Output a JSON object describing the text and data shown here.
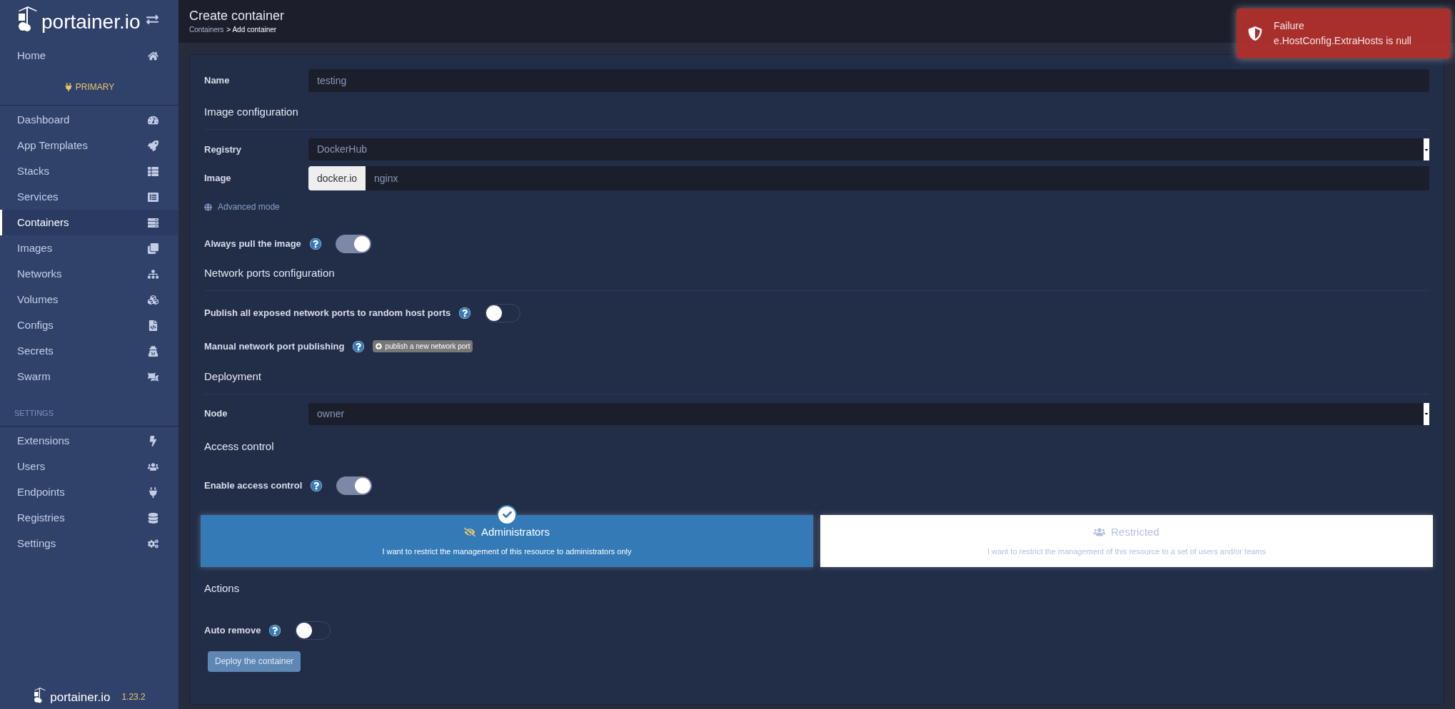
{
  "sidebar": {
    "logo": "portainer.io",
    "home": {
      "label": "Home",
      "selected": false
    },
    "endpoint": "PRIMARY",
    "items": [
      {
        "label": "Dashboard",
        "selected": false
      },
      {
        "label": "App Templates",
        "selected": false
      },
      {
        "label": "Stacks",
        "selected": false
      },
      {
        "label": "Services",
        "selected": false
      },
      {
        "label": "Containers",
        "selected": true
      },
      {
        "label": "Images",
        "selected": false
      },
      {
        "label": "Networks",
        "selected": false
      },
      {
        "label": "Volumes",
        "selected": false
      },
      {
        "label": "Configs",
        "selected": false
      },
      {
        "label": "Secrets",
        "selected": false
      },
      {
        "label": "Swarm",
        "selected": false
      }
    ],
    "settings_heading": "SETTINGS",
    "settings_items": [
      {
        "label": "Extensions",
        "selected": false
      },
      {
        "label": "Users",
        "selected": false
      },
      {
        "label": "Endpoints",
        "selected": false
      },
      {
        "label": "Registries",
        "selected": false
      },
      {
        "label": "Settings",
        "selected": false
      }
    ],
    "footer": {
      "logo": "portainer.io",
      "version": "1.23.2"
    }
  },
  "header": {
    "title": "Create container",
    "breadcrumb_link": "Containers",
    "breadcrumb_current": "> Add container"
  },
  "toast": {
    "title": "Failure",
    "message": "e.HostConfig.ExtraHosts is null"
  },
  "form": {
    "name": {
      "label": "Name",
      "value": "testing"
    },
    "image_heading": "Image configuration",
    "registry": {
      "label": "Registry",
      "value": "DockerHub"
    },
    "image": {
      "label": "Image",
      "prefix": "docker.io",
      "value": "nginx"
    },
    "advanced_mode": "Advanced mode",
    "always_pull": {
      "label": "Always pull the image",
      "on": true
    },
    "ports_heading": "Network ports configuration",
    "publish_all": {
      "label": "Publish all exposed network ports to random host ports",
      "on": false
    },
    "manual_ports": {
      "label": "Manual network port publishing",
      "button": "publish a new network port"
    },
    "deployment_heading": "Deployment",
    "node": {
      "label": "Node",
      "value": "owner"
    },
    "access_heading": "Access control",
    "access_control": {
      "label": "Enable access control",
      "on": true
    },
    "access_options": [
      {
        "title": "Administrators",
        "description": "I want to restrict the management of this resource to administrators only",
        "selected": true
      },
      {
        "title": "Restricted",
        "description": "I want to restrict the management of this resource to a set of users and/or teams",
        "selected": false
      }
    ],
    "actions_heading": "Actions",
    "auto_remove": {
      "label": "Auto remove",
      "on": false
    },
    "deploy_button": "Deploy the container"
  }
}
